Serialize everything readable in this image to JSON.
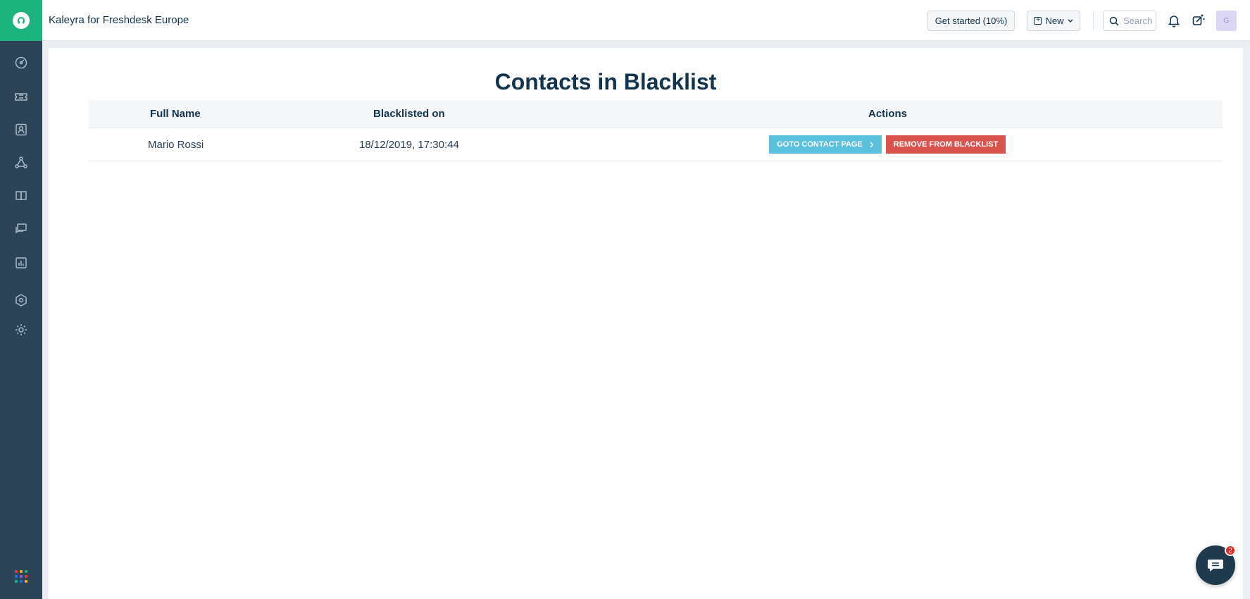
{
  "header": {
    "app_title": "Kaleyra for Freshdesk Europe",
    "get_started_label": "Get started (10%)",
    "new_label": "New",
    "search_placeholder": "Search",
    "avatar_initial": "G"
  },
  "sidebar": {
    "items": [
      "dashboard-icon",
      "tickets-icon",
      "contacts-icon",
      "social-icon",
      "solutions-icon",
      "forums-icon",
      "reports-icon",
      "admin-icon",
      "settings-icon"
    ],
    "apps_colors": [
      "#e4373c",
      "#f5a623",
      "#1db37e",
      "#2c6ed5",
      "#7b61c9",
      "#e4373c",
      "#1db37e",
      "#2c6ed5",
      "#f5a623"
    ]
  },
  "main": {
    "title": "Contacts in Blacklist",
    "columns": [
      "Full Name",
      "Blacklisted on",
      "Actions"
    ],
    "rows": [
      {
        "full_name": "Mario Rossi",
        "blacklisted_on": "18/12/2019, 17:30:44",
        "goto_label": "GOTO CONTACT PAGE",
        "remove_label": "REMOVE FROM BLACKLIST"
      }
    ]
  },
  "chat": {
    "badge_count": "2"
  },
  "colors": {
    "brand_green": "#1db37e",
    "sidebar_bg": "#2c4458",
    "goto_button": "#5bc0de",
    "remove_button": "#d9534f"
  }
}
